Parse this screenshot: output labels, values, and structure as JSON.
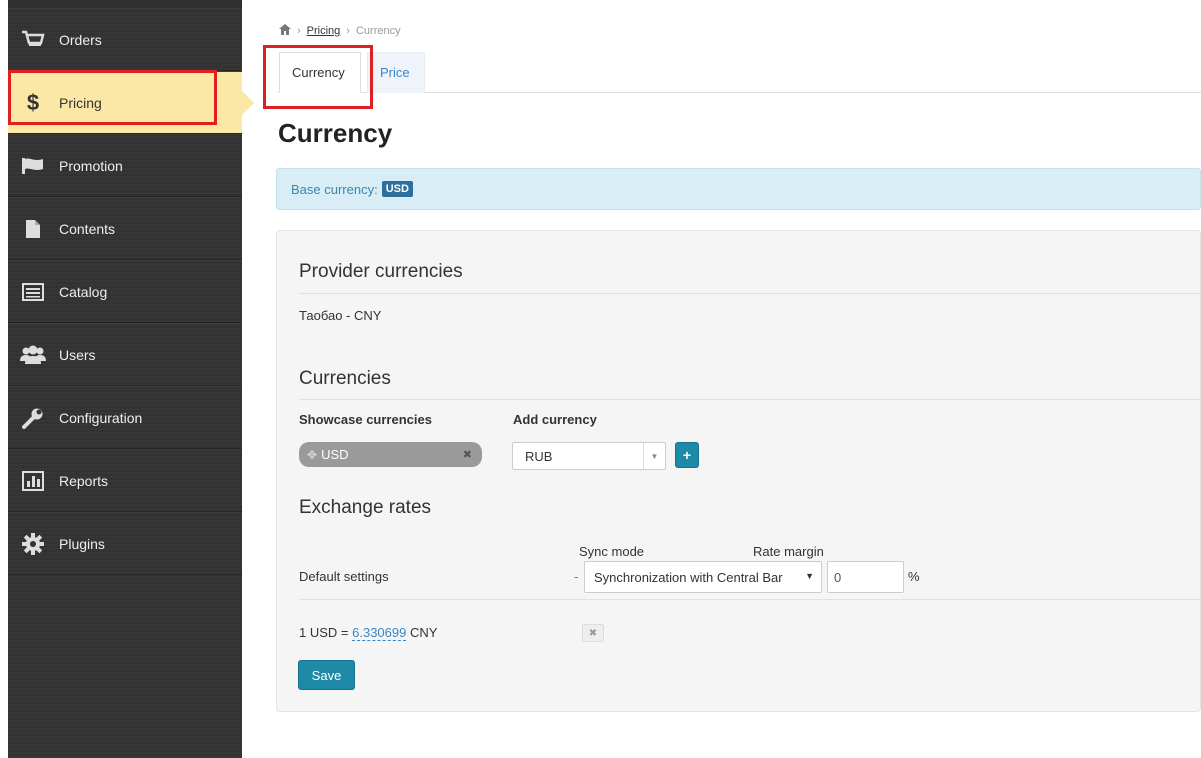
{
  "sidebar": {
    "items": [
      {
        "label": "Orders",
        "icon": "cart-icon"
      },
      {
        "label": "Pricing",
        "icon": "dollar-icon"
      },
      {
        "label": "Promotion",
        "icon": "flag-icon"
      },
      {
        "label": "Contents",
        "icon": "document-icon"
      },
      {
        "label": "Catalog",
        "icon": "list-icon"
      },
      {
        "label": "Users",
        "icon": "users-icon"
      },
      {
        "label": "Configuration",
        "icon": "wrench-icon"
      },
      {
        "label": "Reports",
        "icon": "chart-icon"
      },
      {
        "label": "Plugins",
        "icon": "gear-icon"
      }
    ],
    "active": "Pricing"
  },
  "breadcrumb": {
    "home_icon": "home-icon",
    "sep": "›",
    "pricing": "Pricing",
    "current": "Currency"
  },
  "tabs": [
    {
      "label": "Currency"
    },
    {
      "label": "Price"
    }
  ],
  "page": {
    "title": "Currency"
  },
  "alert": {
    "label": "Base currency:",
    "badge": "USD"
  },
  "provider": {
    "title": "Provider currencies",
    "value": "Таобао - CNY"
  },
  "currencies": {
    "title": "Currencies",
    "showcase_label": "Showcase currencies",
    "add_label": "Add currency",
    "chip": "USD",
    "chip_remove": "✖",
    "add_select": "RUB",
    "add_button": "+"
  },
  "exchange": {
    "title": "Exchange rates",
    "sync_mode_label": "Sync mode",
    "rate_margin_label": "Rate margin",
    "default_label": "Default settings",
    "dash": "-",
    "sync_mode_value": "Synchronization with Central Bar",
    "rate_margin_value": "0",
    "percent": "%",
    "rate_prefix": "1 USD =",
    "rate_value": "6.330699",
    "rate_suffix": "CNY",
    "remove": "✖"
  },
  "save_label": "Save",
  "colors": {
    "accent": "#1f8aa8",
    "highlight": "#e02020",
    "active_nav": "#fbe8a6"
  }
}
